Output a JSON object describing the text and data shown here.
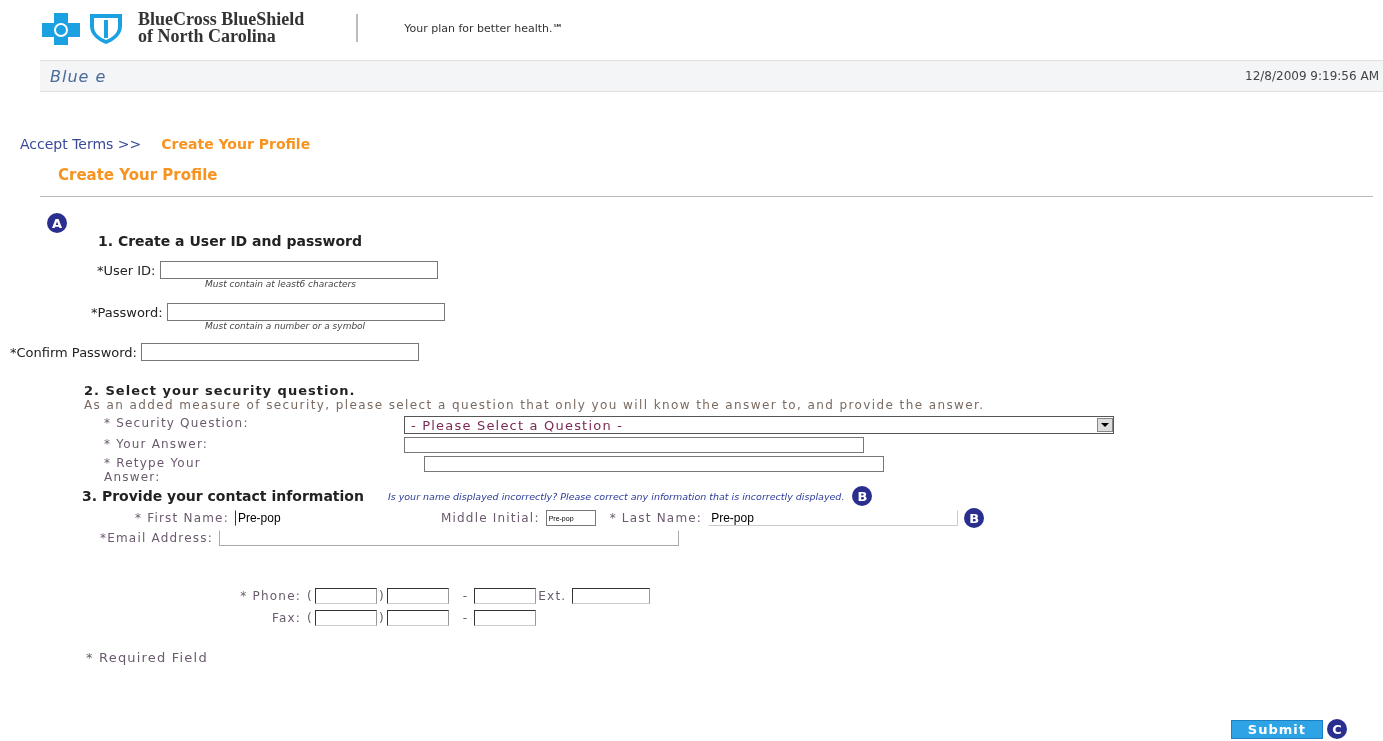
{
  "header": {
    "brand_line1": "BlueCross BlueShield",
    "brand_line2": "of North Carolina",
    "tagline": "Your plan for better health.℠"
  },
  "app_bar": {
    "title": "Blue e",
    "timestamp": "12/8/2009 9:19:56 AM"
  },
  "breadcrumb": [
    {
      "label": "Accept Terms >>",
      "selected": false
    },
    {
      "label": "Create Your Profile",
      "selected": true
    }
  ],
  "page_title": "Create Your Profile",
  "section1": {
    "marker": "A",
    "heading": "1. Create a User ID and password",
    "fields": [
      {
        "label": "*User ID:",
        "hint": "Must contain at least6 characters"
      },
      {
        "label": "*Password:",
        "hint": "Must contain a number or a symbol"
      },
      {
        "label": "*Confirm Password:"
      }
    ]
  },
  "section2": {
    "heading": "2. Select your security question.",
    "description": "As an added measure of security, please select a question that only you will know the answer to, and provide the answer.",
    "fields": [
      {
        "kind": "select",
        "label": "* Security Question:",
        "value": "- Please Select a Question -"
      },
      {
        "kind": "text",
        "label": "* Your Answer:"
      },
      {
        "kind": "text",
        "label": "* Retype Your Answer:"
      }
    ]
  },
  "section3": {
    "heading": "3. Provide your contact information",
    "notice": "Is your name displayed incorrectly? Please correct any information that is incorrectly displayed.",
    "notice_marker": "B",
    "first_name": {
      "label": "* First Name:",
      "value": "Pre-pop"
    },
    "middle_initial": {
      "label": "Middle Initial:",
      "value": "Pre-pop"
    },
    "last_name": {
      "label": "* Last Name:",
      "value": "Pre-pop",
      "marker": "B"
    },
    "email": {
      "label": "*Email Address:"
    },
    "phone": {
      "label": "* Phone:",
      "open": "(",
      "close": ")",
      "dash": "-",
      "ext_label": "Ext."
    },
    "fax": {
      "label": "Fax:",
      "open": "(",
      "close": ")",
      "dash": "-"
    }
  },
  "required_note": "* Required Field",
  "submit": {
    "label": "Submit",
    "marker": "C"
  }
}
